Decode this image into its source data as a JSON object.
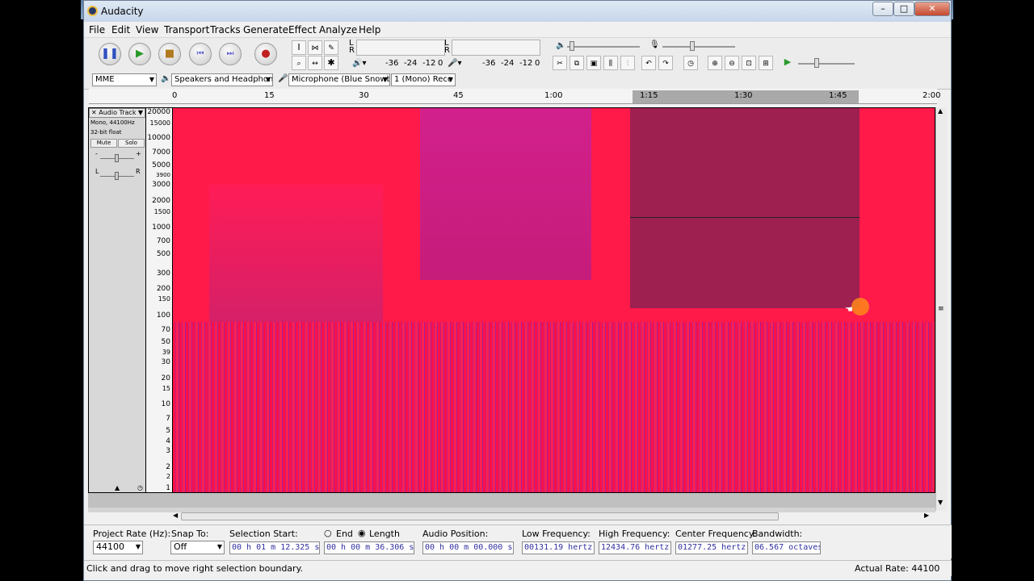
{
  "window": {
    "title": "Audacity"
  },
  "window_controls": {
    "minimize": "–",
    "maximize": "□",
    "close": "✕"
  },
  "menu": [
    "File",
    "Edit",
    "View",
    "Transport",
    "Tracks",
    "Generate",
    "Effect",
    "Analyze",
    "Help"
  ],
  "transport": {
    "pause": "pause-icon",
    "play": "play-icon",
    "stop": "stop-icon",
    "skip_start": "skip-start-icon",
    "skip_end": "skip-end-icon",
    "record": "record-icon"
  },
  "meters": {
    "play_ticks": [
      "-36",
      "-24",
      "-12",
      "0"
    ],
    "rec_ticks": [
      "-36",
      "-24",
      "-12",
      "0"
    ],
    "l_label": "L",
    "r_label": "R"
  },
  "device": {
    "host": "MME",
    "output": "Speakers and Headphon",
    "input": "Microphone (Blue Snowb",
    "channels": "1 (Mono) Reco"
  },
  "timeline": {
    "labels": [
      "0",
      "15",
      "30",
      "45",
      "1:00",
      "1:15",
      "1:30",
      "1:45",
      "2:00"
    ]
  },
  "track": {
    "name": "Audio Track",
    "info1": "Mono, 44100Hz",
    "info2": "32-bit float",
    "mute": "Mute",
    "solo": "Solo",
    "gain_minus": "-",
    "gain_plus": "+",
    "pan_l": "L",
    "pan_r": "R"
  },
  "freq_axis": [
    "20000",
    "15000",
    "10000",
    "7000",
    "5000",
    "3900",
    "3000",
    "2000",
    "1500",
    "1000",
    "700",
    "500",
    "300",
    "200",
    "150",
    "100",
    "70",
    "50",
    "39",
    "30",
    "20",
    "15",
    "10",
    "7",
    "5",
    "4",
    "3",
    "2",
    "2",
    "1"
  ],
  "selection_bar": {
    "project_rate_label": "Project Rate (Hz):",
    "project_rate": "44100",
    "snap_label": "Snap To:",
    "snap_value": "Off",
    "sel_start_label": "Selection Start:",
    "end_label": "End",
    "length_label": "Length",
    "sel_start": "00 h 01 m 12.325 s",
    "length": "00 h 00 m 36.306 s",
    "audio_pos_label": "Audio Position:",
    "audio_pos": "00 h 00 m 00.000 s",
    "low_freq_label": "Low Frequency:",
    "low_freq": "00131.19 hertz",
    "high_freq_label": "High Frequency:",
    "high_freq": "12434.76 hertz",
    "center_freq_label": "Center Frequency:",
    "center_freq": "01277.25 hertz",
    "bandwidth_label": "Bandwidth:",
    "bandwidth": "06.567 octaves"
  },
  "status": {
    "message": "Click and drag to move right selection boundary.",
    "actual_rate": "Actual Rate: 44100"
  }
}
